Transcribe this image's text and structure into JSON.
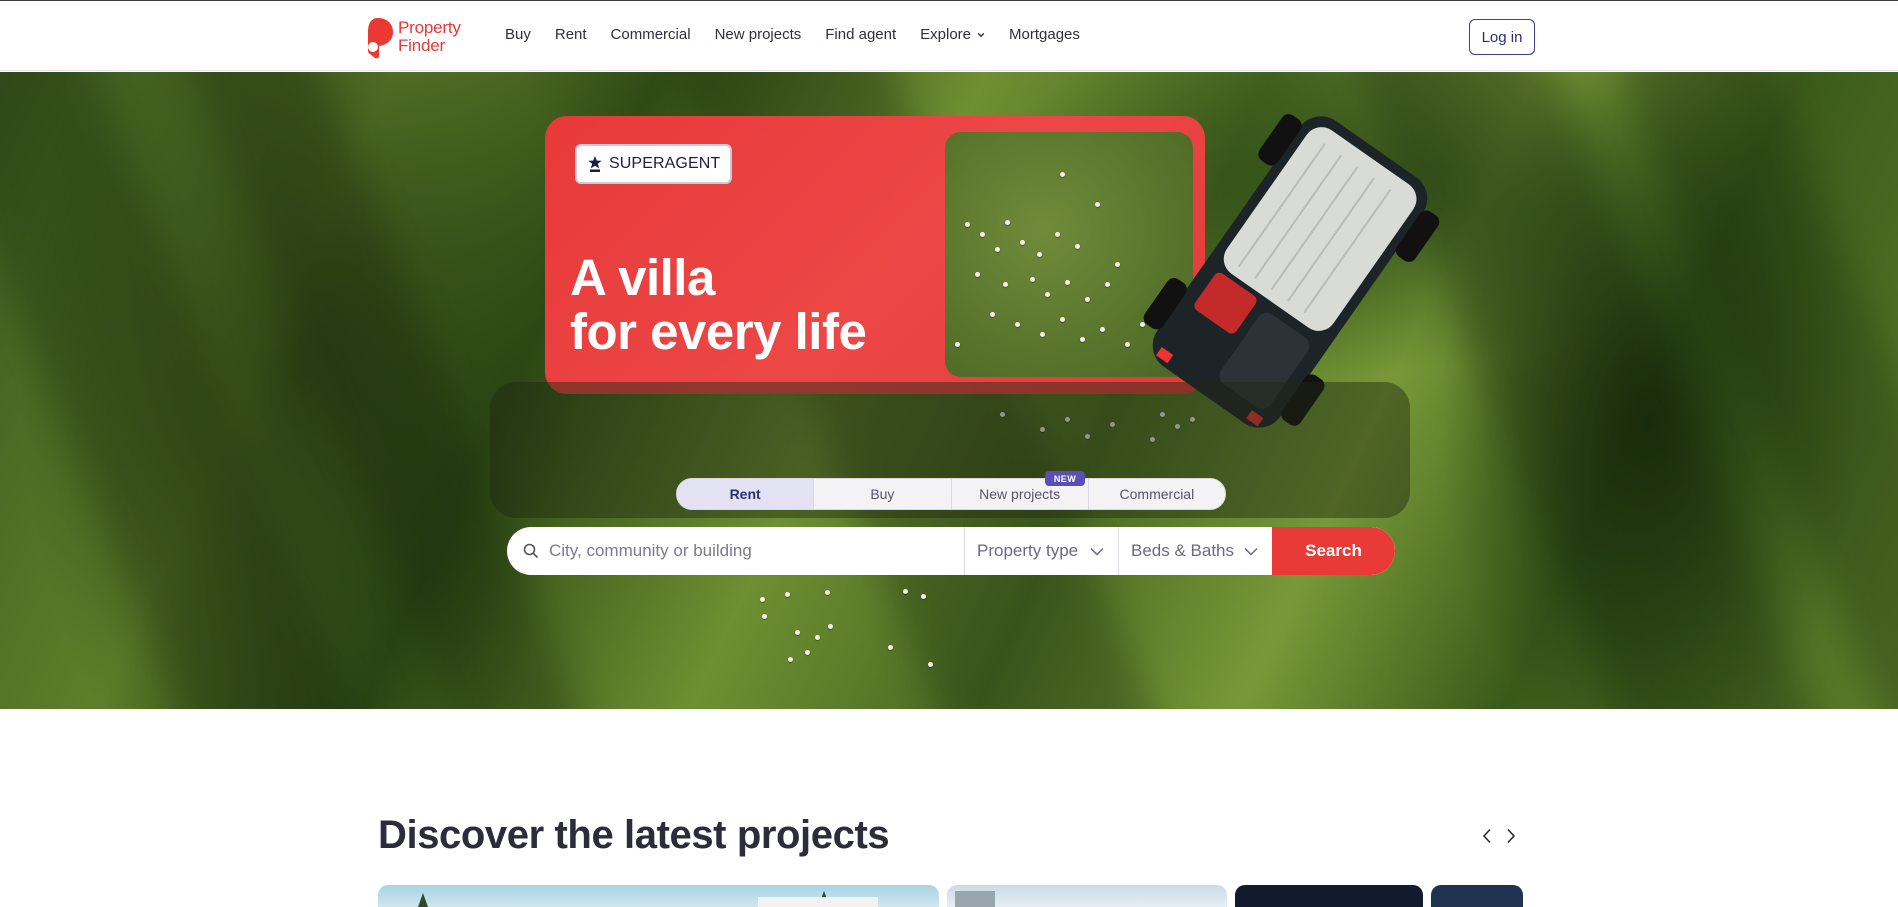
{
  "header": {
    "logo": {
      "line1": "Property",
      "line2": "Finder",
      "color": "#ea3934"
    },
    "nav": [
      {
        "label": "Buy"
      },
      {
        "label": "Rent"
      },
      {
        "label": "Commercial"
      },
      {
        "label": "New projects"
      },
      {
        "label": "Find agent"
      },
      {
        "label": "Explore",
        "has_dropdown": true
      },
      {
        "label": "Mortgages"
      }
    ],
    "login_label": "Log in"
  },
  "hero": {
    "badge": {
      "label": "SUPERAGENT",
      "icon": "superagent-star-icon"
    },
    "title_line1": "A villa",
    "title_line2": "for every life",
    "accent": "#e8393a"
  },
  "search": {
    "tabs": [
      {
        "label": "Rent",
        "active": true
      },
      {
        "label": "Buy",
        "active": false
      },
      {
        "label": "New projects",
        "active": false
      },
      {
        "label": "Commercial",
        "active": false
      }
    ],
    "new_badge": "NEW",
    "placeholder": "City, community or building",
    "property_type": "Property type",
    "beds_baths": "Beds & Baths",
    "button": "Search",
    "button_color": "#e83a36"
  },
  "discover": {
    "title": "Discover the latest projects"
  }
}
